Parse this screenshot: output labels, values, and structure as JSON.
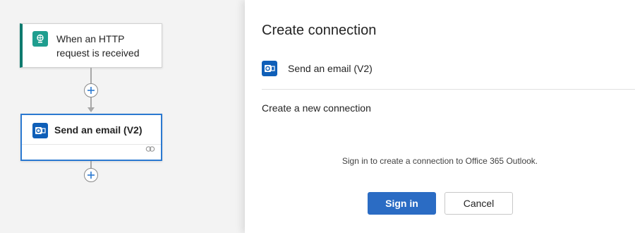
{
  "designer": {
    "trigger": {
      "title": "When an HTTP request is received",
      "icon": "http-request-icon"
    },
    "action": {
      "title": "Send an email (V2)",
      "icon": "outlook-icon",
      "connection_icon": "link-icon"
    },
    "add_step_icon": "plus-icon"
  },
  "panel": {
    "title": "Create connection",
    "connector_name": "Send an email (V2)",
    "section_title": "Create a new connection",
    "signin_message": "Sign in to create a connection to Office 365 Outlook.",
    "signin_button": "Sign in",
    "cancel_button": "Cancel"
  },
  "colors": {
    "trigger_accent": "#0e7a6e",
    "trigger_tile": "#1f9e8f",
    "outlook_tile": "#0f5fb8",
    "selected_border": "#2b79d1",
    "primary_button": "#2b6cc4"
  }
}
